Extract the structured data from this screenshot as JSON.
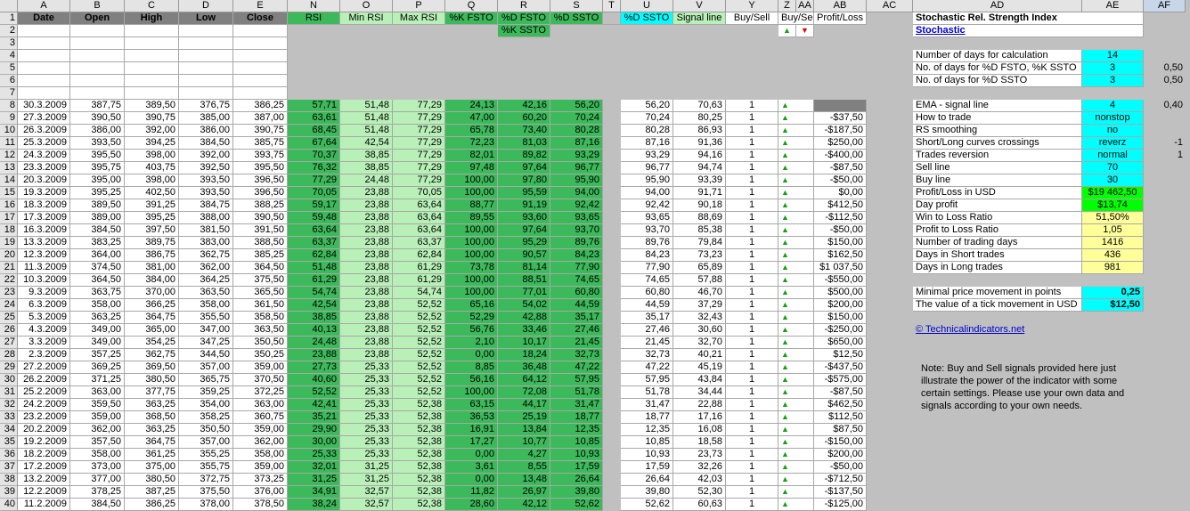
{
  "colors": {
    "hdr_gray": "#c0c0c0",
    "green": "#3cb95a",
    "light_green": "#b8f0b8",
    "cyan": "#00ffff",
    "bright_green": "#00ff00",
    "yellow": "#ffff99",
    "dark_gray": "#808080"
  },
  "columns": [
    {
      "letter": "A",
      "w": 59
    },
    {
      "letter": "B",
      "w": 61
    },
    {
      "letter": "C",
      "w": 61
    },
    {
      "letter": "D",
      "w": 61
    },
    {
      "letter": "E",
      "w": 61
    },
    {
      "letter": "N",
      "w": 59
    },
    {
      "letter": "O",
      "w": 59
    },
    {
      "letter": "P",
      "w": 59
    },
    {
      "letter": "Q",
      "w": 59
    },
    {
      "letter": "R",
      "w": 59
    },
    {
      "letter": "S",
      "w": 59
    },
    {
      "letter": "T",
      "w": 20
    },
    {
      "letter": "U",
      "w": 59
    },
    {
      "letter": "V",
      "w": 59
    },
    {
      "letter": "Y",
      "w": 59
    },
    {
      "letter": "Z",
      "w": 20
    },
    {
      "letter": "AA",
      "w": 20
    },
    {
      "letter": "AB",
      "w": 59
    },
    {
      "letter": "AC",
      "w": 52
    },
    {
      "letter": "AD",
      "w": 190
    },
    {
      "letter": "AE",
      "w": 69
    },
    {
      "letter": "AF",
      "w": 47
    }
  ],
  "row_numbers": [
    "1",
    "2",
    "3",
    "4",
    "5",
    "6",
    "7",
    "8",
    "9",
    "10",
    "11",
    "12",
    "13",
    "14",
    "15",
    "16",
    "17",
    "18",
    "19",
    "20",
    "21",
    "22",
    "23",
    "24",
    "25",
    "26",
    "27",
    "28",
    "29",
    "30",
    "31",
    "32",
    "33",
    "34",
    "35",
    "36",
    "37",
    "38",
    "39",
    "40"
  ],
  "headers": {
    "date": "Date",
    "open": "Open",
    "high": "High",
    "low": "Low",
    "close": "Close",
    "rsi": "RSI",
    "min_rsi": "Min RSI",
    "max_rsi": "Max RSI",
    "k_fsto": "%K FSTO",
    "d_fsto": "%D FSTO",
    "k_ssto": "%K SSTO",
    "d_ssto_s": "%D SSTO",
    "d_ssto_u": "%D SSTO",
    "signal": "Signal line",
    "buy_sell": "Buy/Sell",
    "buy_sell2": "Buy/Sell",
    "profit_loss": "Profit/Loss"
  },
  "rows": [
    {
      "date": "30.3.2009",
      "open": "387,75",
      "high": "389,50",
      "low": "376,75",
      "close": "386,25",
      "rsi": "57,71",
      "min": "51,48",
      "max": "77,29",
      "kf": "24,13",
      "df": "42,16",
      "dss": "56,20",
      "u": "56,20",
      "v": "70,63",
      "y": "1",
      "pl": ""
    },
    {
      "date": "27.3.2009",
      "open": "390,50",
      "high": "390,75",
      "low": "385,00",
      "close": "387,00",
      "rsi": "63,61",
      "min": "51,48",
      "max": "77,29",
      "kf": "47,00",
      "df": "60,20",
      "dss": "70,24",
      "u": "70,24",
      "v": "80,25",
      "y": "1",
      "pl": "-$37,50"
    },
    {
      "date": "26.3.2009",
      "open": "386,00",
      "high": "392,00",
      "low": "386,00",
      "close": "390,75",
      "rsi": "68,45",
      "min": "51,48",
      "max": "77,29",
      "kf": "65,78",
      "df": "73,40",
      "dss": "80,28",
      "u": "80,28",
      "v": "86,93",
      "y": "1",
      "pl": "-$187,50"
    },
    {
      "date": "25.3.2009",
      "open": "393,50",
      "high": "394,25",
      "low": "384,50",
      "close": "385,75",
      "rsi": "67,64",
      "min": "42,54",
      "max": "77,29",
      "kf": "72,23",
      "df": "81,03",
      "dss": "87,16",
      "u": "87,16",
      "v": "91,36",
      "y": "1",
      "pl": "$250,00"
    },
    {
      "date": "24.3.2009",
      "open": "395,50",
      "high": "398,00",
      "low": "392,00",
      "close": "393,75",
      "rsi": "70,37",
      "min": "38,85",
      "max": "77,29",
      "kf": "82,01",
      "df": "89,82",
      "dss": "93,29",
      "u": "93,29",
      "v": "94,16",
      "y": "1",
      "pl": "-$400,00"
    },
    {
      "date": "23.3.2009",
      "open": "395,75",
      "high": "403,75",
      "low": "392,50",
      "close": "395,50",
      "rsi": "76,32",
      "min": "38,85",
      "max": "77,29",
      "kf": "97,48",
      "df": "97,64",
      "dss": "96,77",
      "u": "96,77",
      "v": "94,74",
      "y": "1",
      "pl": "-$87,50"
    },
    {
      "date": "20.3.2009",
      "open": "395,00",
      "high": "398,00",
      "low": "393,50",
      "close": "396,50",
      "rsi": "77,29",
      "min": "24,48",
      "max": "77,29",
      "kf": "100,00",
      "df": "97,80",
      "dss": "95,90",
      "u": "95,90",
      "v": "93,39",
      "y": "1",
      "pl": "-$50,00"
    },
    {
      "date": "19.3.2009",
      "open": "395,25",
      "high": "402,50",
      "low": "393,50",
      "close": "396,50",
      "rsi": "70,05",
      "min": "23,88",
      "max": "70,05",
      "kf": "100,00",
      "df": "95,59",
      "dss": "94,00",
      "u": "94,00",
      "v": "91,71",
      "y": "1",
      "pl": "$0,00"
    },
    {
      "date": "18.3.2009",
      "open": "389,50",
      "high": "391,25",
      "low": "384,75",
      "close": "388,25",
      "rsi": "59,17",
      "min": "23,88",
      "max": "63,64",
      "kf": "88,77",
      "df": "91,19",
      "dss": "92,42",
      "u": "92,42",
      "v": "90,18",
      "y": "1",
      "pl": "$412,50"
    },
    {
      "date": "17.3.2009",
      "open": "389,00",
      "high": "395,25",
      "low": "388,00",
      "close": "390,50",
      "rsi": "59,48",
      "min": "23,88",
      "max": "63,64",
      "kf": "89,55",
      "df": "93,60",
      "dss": "93,65",
      "u": "93,65",
      "v": "88,69",
      "y": "1",
      "pl": "-$112,50"
    },
    {
      "date": "16.3.2009",
      "open": "384,50",
      "high": "397,50",
      "low": "381,50",
      "close": "391,50",
      "rsi": "63,64",
      "min": "23,88",
      "max": "63,64",
      "kf": "100,00",
      "df": "97,64",
      "dss": "93,70",
      "u": "93,70",
      "v": "85,38",
      "y": "1",
      "pl": "-$50,00"
    },
    {
      "date": "13.3.2009",
      "open": "383,25",
      "high": "389,75",
      "low": "383,00",
      "close": "388,50",
      "rsi": "63,37",
      "min": "23,88",
      "max": "63,37",
      "kf": "100,00",
      "df": "95,29",
      "dss": "89,76",
      "u": "89,76",
      "v": "79,84",
      "y": "1",
      "pl": "$150,00"
    },
    {
      "date": "12.3.2009",
      "open": "364,00",
      "high": "386,75",
      "low": "362,75",
      "close": "385,25",
      "rsi": "62,84",
      "min": "23,88",
      "max": "62,84",
      "kf": "100,00",
      "df": "90,57",
      "dss": "84,23",
      "u": "84,23",
      "v": "73,23",
      "y": "1",
      "pl": "$162,50"
    },
    {
      "date": "11.3.2009",
      "open": "374,50",
      "high": "381,00",
      "low": "362,00",
      "close": "364,50",
      "rsi": "51,48",
      "min": "23,88",
      "max": "61,29",
      "kf": "73,78",
      "df": "81,14",
      "dss": "77,90",
      "u": "77,90",
      "v": "65,89",
      "y": "1",
      "pl": "$1 037,50"
    },
    {
      "date": "10.3.2009",
      "open": "364,50",
      "high": "384,00",
      "low": "364,25",
      "close": "375,50",
      "rsi": "61,29",
      "min": "23,88",
      "max": "61,29",
      "kf": "100,00",
      "df": "88,51",
      "dss": "74,65",
      "u": "74,65",
      "v": "57,88",
      "y": "1",
      "pl": "-$550,00"
    },
    {
      "date": "9.3.2009",
      "open": "363,75",
      "high": "370,00",
      "low": "363,50",
      "close": "365,50",
      "rsi": "54,74",
      "min": "23,88",
      "max": "54,74",
      "kf": "100,00",
      "df": "77,01",
      "dss": "60,80",
      "u": "60,80",
      "v": "46,70",
      "y": "1",
      "pl": "$500,00"
    },
    {
      "date": "6.3.2009",
      "open": "358,00",
      "high": "366,25",
      "low": "358,00",
      "close": "361,50",
      "rsi": "42,54",
      "min": "23,88",
      "max": "52,52",
      "kf": "65,16",
      "df": "54,02",
      "dss": "44,59",
      "u": "44,59",
      "v": "37,29",
      "y": "1",
      "pl": "$200,00"
    },
    {
      "date": "5.3.2009",
      "open": "363,25",
      "high": "364,75",
      "low": "355,50",
      "close": "358,50",
      "rsi": "38,85",
      "min": "23,88",
      "max": "52,52",
      "kf": "52,29",
      "df": "42,88",
      "dss": "35,17",
      "u": "35,17",
      "v": "32,43",
      "y": "1",
      "pl": "$150,00"
    },
    {
      "date": "4.3.2009",
      "open": "349,00",
      "high": "365,00",
      "low": "347,00",
      "close": "363,50",
      "rsi": "40,13",
      "min": "23,88",
      "max": "52,52",
      "kf": "56,76",
      "df": "33,46",
      "dss": "27,46",
      "u": "27,46",
      "v": "30,60",
      "y": "1",
      "pl": "-$250,00"
    },
    {
      "date": "3.3.2009",
      "open": "349,00",
      "high": "354,25",
      "low": "347,25",
      "close": "350,50",
      "rsi": "24,48",
      "min": "23,88",
      "max": "52,52",
      "kf": "2,10",
      "df": "10,17",
      "dss": "21,45",
      "u": "21,45",
      "v": "32,70",
      "y": "1",
      "pl": "$650,00"
    },
    {
      "date": "2.3.2009",
      "open": "357,25",
      "high": "362,75",
      "low": "344,50",
      "close": "350,25",
      "rsi": "23,88",
      "min": "23,88",
      "max": "52,52",
      "kf": "0,00",
      "df": "18,24",
      "dss": "32,73",
      "u": "32,73",
      "v": "40,21",
      "y": "1",
      "pl": "$12,50"
    },
    {
      "date": "27.2.2009",
      "open": "369,25",
      "high": "369,50",
      "low": "357,00",
      "close": "359,00",
      "rsi": "27,73",
      "min": "25,33",
      "max": "52,52",
      "kf": "8,85",
      "df": "36,48",
      "dss": "47,22",
      "u": "47,22",
      "v": "45,19",
      "y": "1",
      "pl": "-$437,50"
    },
    {
      "date": "26.2.2009",
      "open": "371,25",
      "high": "380,50",
      "low": "365,75",
      "close": "370,50",
      "rsi": "40,60",
      "min": "25,33",
      "max": "52,52",
      "kf": "56,16",
      "df": "64,12",
      "dss": "57,95",
      "u": "57,95",
      "v": "43,84",
      "y": "1",
      "pl": "-$575,00"
    },
    {
      "date": "25.2.2009",
      "open": "363,00",
      "high": "377,75",
      "low": "359,25",
      "close": "372,25",
      "rsi": "52,52",
      "min": "25,33",
      "max": "52,52",
      "kf": "100,00",
      "df": "72,08",
      "dss": "51,78",
      "u": "51,78",
      "v": "34,44",
      "y": "1",
      "pl": "-$87,50"
    },
    {
      "date": "24.2.2009",
      "open": "359,50",
      "high": "363,25",
      "low": "354,00",
      "close": "363,00",
      "rsi": "42,41",
      "min": "25,33",
      "max": "52,38",
      "kf": "63,15",
      "df": "44,17",
      "dss": "31,47",
      "u": "31,47",
      "v": "22,88",
      "y": "1",
      "pl": "$462,50"
    },
    {
      "date": "23.2.2009",
      "open": "359,00",
      "high": "368,50",
      "low": "358,25",
      "close": "360,75",
      "rsi": "35,21",
      "min": "25,33",
      "max": "52,38",
      "kf": "36,53",
      "df": "25,19",
      "dss": "18,77",
      "u": "18,77",
      "v": "17,16",
      "y": "1",
      "pl": "$112,50"
    },
    {
      "date": "20.2.2009",
      "open": "362,00",
      "high": "363,25",
      "low": "350,50",
      "close": "359,00",
      "rsi": "29,90",
      "min": "25,33",
      "max": "52,38",
      "kf": "16,91",
      "df": "13,84",
      "dss": "12,35",
      "u": "12,35",
      "v": "16,08",
      "y": "1",
      "pl": "$87,50"
    },
    {
      "date": "19.2.2009",
      "open": "357,50",
      "high": "364,75",
      "low": "357,00",
      "close": "362,00",
      "rsi": "30,00",
      "min": "25,33",
      "max": "52,38",
      "kf": "17,27",
      "df": "10,77",
      "dss": "10,85",
      "u": "10,85",
      "v": "18,58",
      "y": "1",
      "pl": "-$150,00"
    },
    {
      "date": "18.2.2009",
      "open": "358,00",
      "high": "361,25",
      "low": "355,25",
      "close": "358,00",
      "rsi": "25,33",
      "min": "25,33",
      "max": "52,38",
      "kf": "0,00",
      "df": "4,27",
      "dss": "10,93",
      "u": "10,93",
      "v": "23,73",
      "y": "1",
      "pl": "$200,00"
    },
    {
      "date": "17.2.2009",
      "open": "373,00",
      "high": "375,00",
      "low": "355,75",
      "close": "359,00",
      "rsi": "32,01",
      "min": "31,25",
      "max": "52,38",
      "kf": "3,61",
      "df": "8,55",
      "dss": "17,59",
      "u": "17,59",
      "v": "32,26",
      "y": "1",
      "pl": "-$50,00"
    },
    {
      "date": "13.2.2009",
      "open": "377,00",
      "high": "380,50",
      "low": "372,75",
      "close": "373,25",
      "rsi": "31,25",
      "min": "31,25",
      "max": "52,38",
      "kf": "0,00",
      "df": "13,48",
      "dss": "26,64",
      "u": "26,64",
      "v": "42,03",
      "y": "1",
      "pl": "-$712,50"
    },
    {
      "date": "12.2.2009",
      "open": "378,25",
      "high": "387,25",
      "low": "375,50",
      "close": "376,00",
      "rsi": "34,91",
      "min": "32,57",
      "max": "52,38",
      "kf": "11,82",
      "df": "26,97",
      "dss": "39,80",
      "u": "39,80",
      "v": "52,30",
      "y": "1",
      "pl": "-$137,50"
    },
    {
      "date": "11.2.2009",
      "open": "384,50",
      "high": "386,25",
      "low": "378,00",
      "close": "378,50",
      "rsi": "38,24",
      "min": "32,57",
      "max": "52,38",
      "kf": "28,60",
      "df": "42,12",
      "dss": "52,62",
      "u": "52,62",
      "v": "60,63",
      "y": "1",
      "pl": "-$125,00"
    }
  ],
  "panel": {
    "title": "Stochastic Rel. Strength Index",
    "link": "Stochastic",
    "params1": [
      {
        "label": "Number of days for calculation",
        "value": "14",
        "side": ""
      },
      {
        "label": "No. of days for %D FSTO, %K SSTO",
        "value": "3",
        "side": "0,50"
      },
      {
        "label": "No. of days for %D SSTO",
        "value": "3",
        "side": "0,50"
      }
    ],
    "params2": [
      {
        "label": "EMA - signal line",
        "value": "4",
        "side": "0,40",
        "bg": "cyan"
      },
      {
        "label": "How to trade",
        "value": "nonstop",
        "side": "",
        "bg": "cyan"
      },
      {
        "label": "RS smoothing",
        "value": "no",
        "side": "",
        "bg": "cyan"
      },
      {
        "label": "Short/Long curves crossings",
        "value": "reverz",
        "side": "-1",
        "bg": "cyan"
      },
      {
        "label": "Trades reversion",
        "value": "normal",
        "side": "1",
        "bg": "cyan"
      },
      {
        "label": "Sell line",
        "value": "70",
        "side": "",
        "bg": "cyan"
      },
      {
        "label": "Buy line",
        "value": "30",
        "side": "",
        "bg": "cyan"
      },
      {
        "label": "Profit/Loss in USD",
        "value": "$19 462,50",
        "side": "",
        "bg": "green"
      },
      {
        "label": "Day profit",
        "value": "$13,74",
        "side": "",
        "bg": "green"
      },
      {
        "label": "Win to Loss Ratio",
        "value": "51,50%",
        "side": "",
        "bg": "yellow"
      },
      {
        "label": "Profit to Loss Ratio",
        "value": "1,05",
        "side": "",
        "bg": "yellow"
      },
      {
        "label": "Number of trading days",
        "value": "1416",
        "side": "",
        "bg": "yellow"
      },
      {
        "label": "Days in Short trades",
        "value": "436",
        "side": "",
        "bg": "yellow"
      },
      {
        "label": "Days in Long trades",
        "value": "981",
        "side": "",
        "bg": "yellow"
      }
    ],
    "params3": [
      {
        "label": "Minimal price movement in points",
        "value": "0,25"
      },
      {
        "label": "The value of a tick movement in USD",
        "value": "$12,50"
      }
    ],
    "site_link": "© Technicalindicators.net",
    "note": "Note: Buy and Sell signals provided here just illustrate the power of the indicator with some certain settings. Please use your own data and signals according to your own needs."
  }
}
